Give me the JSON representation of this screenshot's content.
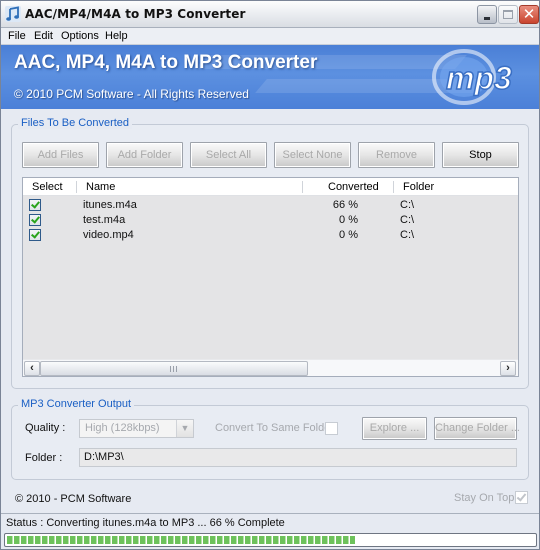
{
  "window": {
    "title": "AAC/MP4/M4A to MP3 Converter",
    "controls": {
      "minimize": "minimize",
      "maximize": "maximize",
      "close": "✕"
    }
  },
  "menu": [
    "File",
    "Edit",
    "Options",
    "Help"
  ],
  "banner": {
    "title": "AAC, MP4, M4A to MP3 Converter",
    "copyright": "© 2010 PCM Software - All Rights Reserved",
    "logo_text": "mp3"
  },
  "files_group": {
    "label": "Files To Be Converted",
    "buttons": [
      {
        "label": "Add Files",
        "enabled": false
      },
      {
        "label": "Add Folder",
        "enabled": false
      },
      {
        "label": "Select All",
        "enabled": false
      },
      {
        "label": "Select None",
        "enabled": false
      },
      {
        "label": "Remove",
        "enabled": false
      },
      {
        "label": "Stop",
        "enabled": true
      }
    ],
    "columns": [
      "Select",
      "Name",
      "Converted",
      "Folder"
    ],
    "rows": [
      {
        "selected": true,
        "name": "itunes.m4a",
        "converted": "66 %",
        "folder": "C:\\"
      },
      {
        "selected": true,
        "name": "test.m4a",
        "converted": "0 %",
        "folder": "C:\\"
      },
      {
        "selected": true,
        "name": "video.mp4",
        "converted": "0 %",
        "folder": "C:\\"
      }
    ]
  },
  "output_group": {
    "label": "MP3 Converter Output",
    "quality_label": "Quality :",
    "quality_value": "High (128kbps)",
    "same_folder_label": "Convert To Same Folder",
    "same_folder_checked": false,
    "explore_label": "Explore ...",
    "change_folder_label": "Change Folder ...",
    "folder_label": "Folder :",
    "folder_value": "D:\\MP3\\"
  },
  "footer": {
    "copyright": "© 2010 - PCM Software",
    "stay_on_top_label": "Stay On Top",
    "stay_on_top_checked": true
  },
  "status": {
    "text": "Status : Converting itunes.m4a to MP3 ... 66 % Complete",
    "progress_percent": 66
  },
  "colors": {
    "banner_blue": "#4f85da",
    "group_label_blue": "#1a5fc4",
    "progress_green": "#6ec25c"
  }
}
